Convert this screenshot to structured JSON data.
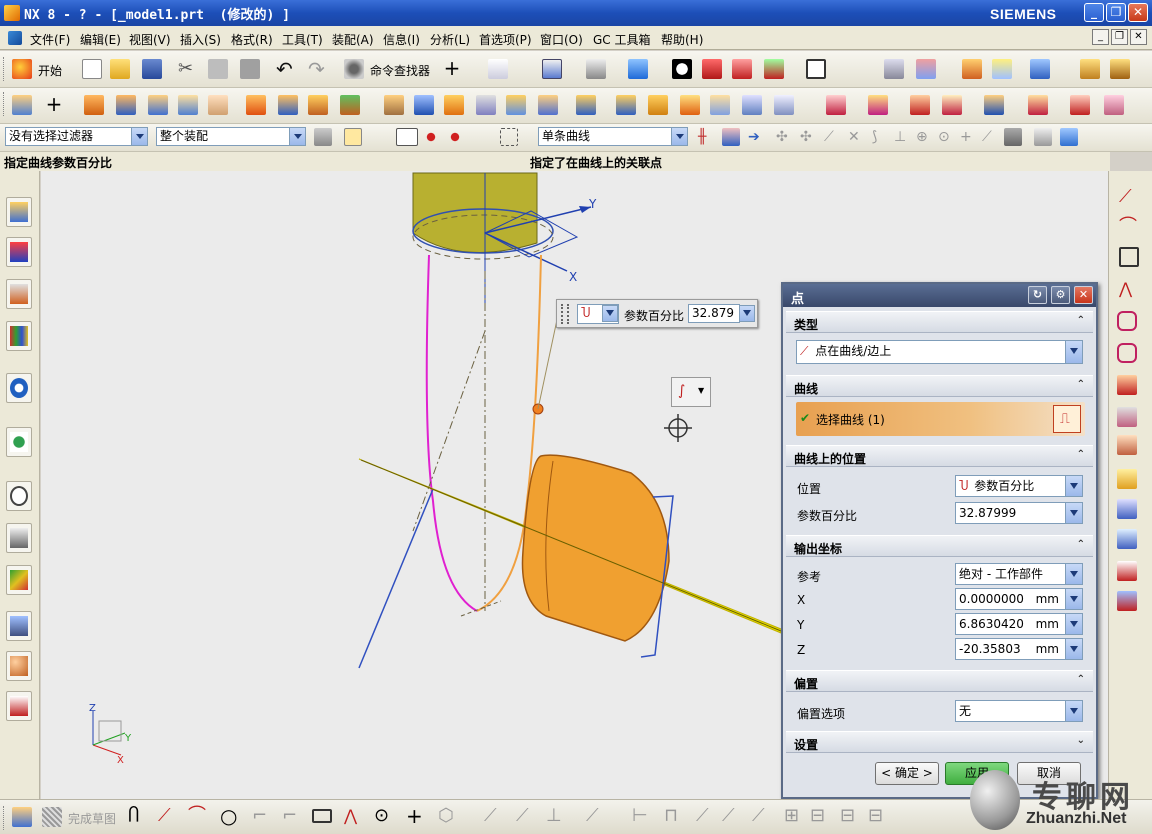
{
  "window": {
    "title": "NX 8 - ? - [_model1.prt  (修改的) ]",
    "brand": "SIEMENS",
    "controls": [
      "_",
      "❐",
      "✕"
    ]
  },
  "menubar": {
    "items": [
      "文件(F)",
      "编辑(E)",
      "视图(V)",
      "插入(S)",
      "格式(R)",
      "工具(T)",
      "装配(A)",
      "信息(I)",
      "分析(L)",
      "首选项(P)",
      "窗口(O)",
      "GC 工具箱",
      "帮助(H)"
    ]
  },
  "toolbar1": {
    "start_label": "开始",
    "command_finder_label": "命令查找器"
  },
  "filterbar": {
    "selection_filter": "没有选择过滤器",
    "assembly_scope": "整个装配",
    "curve_rule": "单条曲线"
  },
  "cue": {
    "left": "指定曲线参数百分比",
    "right": "指定了在曲线上的关联点"
  },
  "viewport": {
    "axis_labels": {
      "x": "X",
      "y": "Y",
      "z": "Z"
    },
    "popup": {
      "label": "参数百分比",
      "value": "32.879"
    }
  },
  "dialog": {
    "title": "点",
    "sections": {
      "type": {
        "header": "类型",
        "value": "点在曲线/边上"
      },
      "curve": {
        "header": "曲线",
        "select_label": "选择曲线 (1)"
      },
      "position": {
        "header": "曲线上的位置",
        "location_label": "位置",
        "location_value": "参数百分比",
        "percent_label": "参数百分比",
        "percent_value": "32.87999"
      },
      "output": {
        "header": "输出坐标",
        "reference_label": "参考",
        "reference_value": "绝对 - 工作部件",
        "x_label": "X",
        "x_value": "0.0000000",
        "y_label": "Y",
        "y_value": "6.8630420",
        "z_label": "Z",
        "z_value": "-20.35803",
        "unit": "mm"
      },
      "offset": {
        "header": "偏置",
        "option_label": "偏置选项",
        "option_value": "无"
      },
      "settings": {
        "header": "设置"
      }
    },
    "buttons": {
      "ok": "< 确定 >",
      "apply": "应用",
      "cancel": "取消"
    }
  },
  "bottombar": {
    "finish_sketch": "完成草图"
  },
  "watermark": {
    "cn": "专聊网",
    "url": "Zhuanzhi.Net"
  },
  "colors": {
    "title_blue": "#1d4fb8",
    "dialog_header": "#39486a",
    "selection_orange": "#e8a050",
    "apply_green": "#3fae3f",
    "part_yellow": "#b8b030",
    "part_orange": "#f0a030"
  }
}
